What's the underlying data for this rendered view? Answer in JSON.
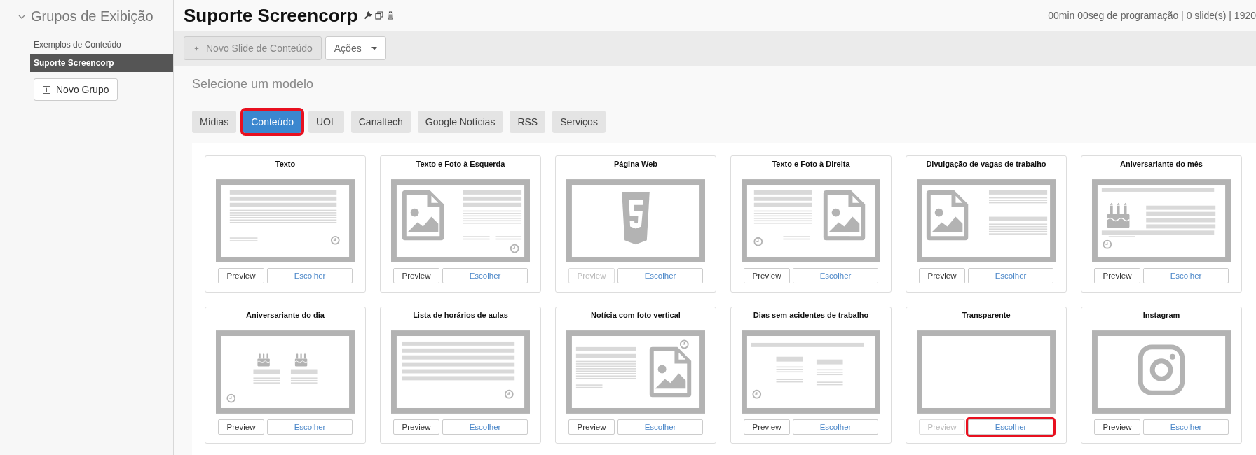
{
  "sidebar": {
    "heading": "Grupos de Exibição",
    "expanded": true,
    "items": [
      {
        "label": "Exemplos de Conteúdo",
        "selected": false
      },
      {
        "label": "Suporte Screencorp",
        "selected": true
      }
    ],
    "new_group_button": "Novo Grupo"
  },
  "header": {
    "title": "Suporte Screencorp",
    "info": "00min 00seg de programação | 0 slide(s) | 1920"
  },
  "toolbar": {
    "new_slide_button": {
      "label": "Novo Slide de Conteúdo",
      "disabled": true
    },
    "actions_button": "Ações"
  },
  "section_title": "Selecione um modelo",
  "tabs": [
    {
      "label": "Mídias",
      "selected": false,
      "highlighted": false
    },
    {
      "label": "Conteúdo",
      "selected": true,
      "highlighted": true
    },
    {
      "label": "UOL",
      "selected": false,
      "highlighted": false
    },
    {
      "label": "Canaltech",
      "selected": false,
      "highlighted": false
    },
    {
      "label": "Google Notícias",
      "selected": false,
      "highlighted": false
    },
    {
      "label": "RSS",
      "selected": false,
      "highlighted": false
    },
    {
      "label": "Serviços",
      "selected": false,
      "highlighted": false
    }
  ],
  "templates": [
    {
      "title": "Texto",
      "kind": "text",
      "preview": "Preview",
      "preview_disabled": false,
      "choose": "Escolher",
      "highlighted": false
    },
    {
      "title": "Texto e Foto à Esquerda",
      "kind": "photo-left",
      "preview": "Preview",
      "preview_disabled": false,
      "choose": "Escolher",
      "highlighted": false
    },
    {
      "title": "Página Web",
      "kind": "html5",
      "preview": "Preview",
      "preview_disabled": true,
      "choose": "Escolher",
      "highlighted": false
    },
    {
      "title": "Texto e Foto à Direita",
      "kind": "photo-right",
      "preview": "Preview",
      "preview_disabled": false,
      "choose": "Escolher",
      "highlighted": false
    },
    {
      "title": "Divulgação de vagas de trabalho",
      "kind": "jobs",
      "preview": "Preview",
      "preview_disabled": false,
      "choose": "Escolher",
      "highlighted": false
    },
    {
      "title": "Aniversariante do mês",
      "kind": "birthday-month",
      "preview": "Preview",
      "preview_disabled": false,
      "choose": "Escolher",
      "highlighted": false
    },
    {
      "title": "Aniversariante do dia",
      "kind": "birthday-day",
      "preview": "Preview",
      "preview_disabled": false,
      "choose": "Escolher",
      "highlighted": false
    },
    {
      "title": "Lista de horários de aulas",
      "kind": "schedule",
      "preview": "Preview",
      "preview_disabled": false,
      "choose": "Escolher",
      "highlighted": false
    },
    {
      "title": "Notícia com foto vertical",
      "kind": "vertical-photo",
      "preview": "Preview",
      "preview_disabled": false,
      "choose": "Escolher",
      "highlighted": false
    },
    {
      "title": "Dias sem acidentes de trabalho",
      "kind": "accidents",
      "preview": "Preview",
      "preview_disabled": false,
      "choose": "Escolher",
      "highlighted": false
    },
    {
      "title": "Transparente",
      "kind": "blank",
      "preview": "Preview",
      "preview_disabled": true,
      "choose": "Escolher",
      "highlighted": true
    },
    {
      "title": "Instagram",
      "kind": "instagram",
      "preview": "Preview",
      "preview_disabled": false,
      "choose": "Escolher",
      "highlighted": false
    }
  ]
}
